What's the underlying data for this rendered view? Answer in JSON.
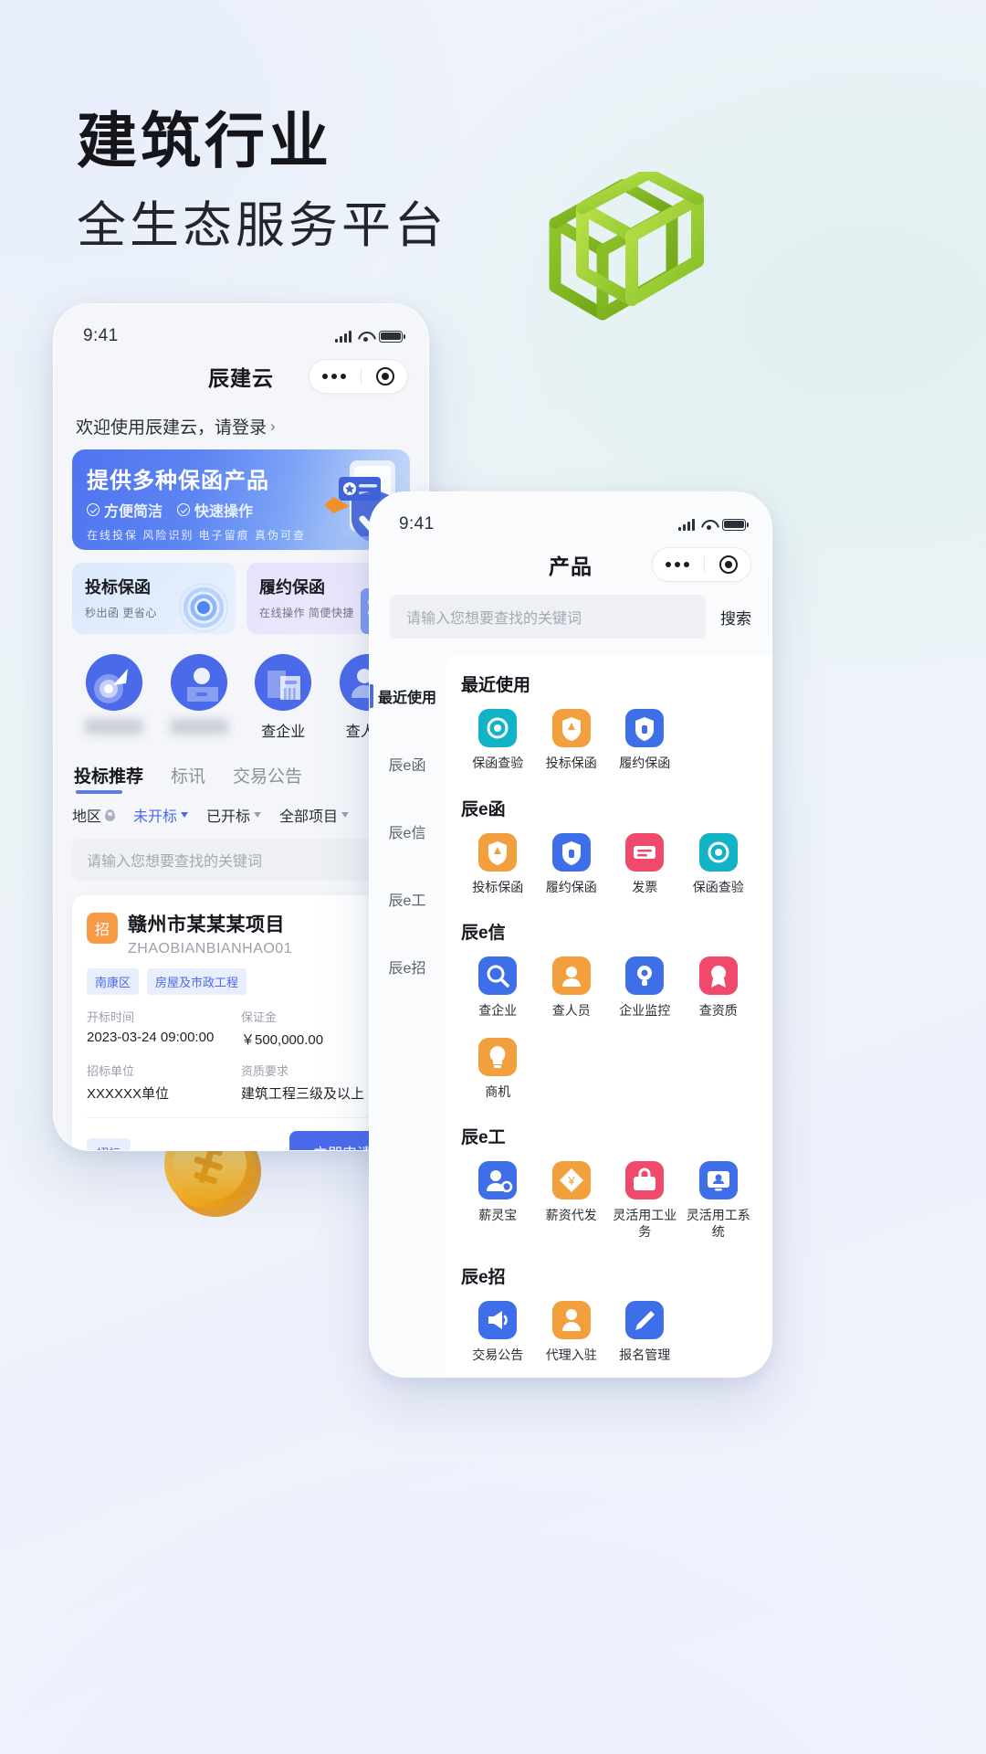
{
  "headline": {
    "line1": "建筑行业",
    "line2": "全生态服务平台"
  },
  "decor": {
    "cube_icon": "wireframe-cube-icon",
    "coin_icon": "gold-coin-icon"
  },
  "phoneA": {
    "status": {
      "time": "9:41",
      "signal_icon": "signal-bars-icon",
      "wifi_icon": "wifi-icon",
      "battery_icon": "battery-icon"
    },
    "nav": {
      "title": "辰建云",
      "more_icon": "more-dots-icon",
      "target_icon": "target-circle-icon"
    },
    "welcome": {
      "text": "欢迎使用辰建云，请登录",
      "chevron": "›"
    },
    "banner": {
      "title": "提供多种保函产品",
      "feature1": "方便简洁",
      "feature2": "快速操作",
      "tags": "在线投保  风险识别  电子留痕  真伪可查",
      "art_icon": "phone-shield-illustration"
    },
    "guarantee_cards": [
      {
        "title": "投标保函",
        "subtitle": "秒出函 更省心",
        "icon": "rings-target-icon"
      },
      {
        "title": "履约保函",
        "subtitle": "在线操作 简便快捷",
        "icon": "document-lines-icon"
      }
    ],
    "quick_icons": [
      {
        "label": "",
        "blurred": true,
        "icon": "bid-target-icon"
      },
      {
        "label": "",
        "blurred": true,
        "icon": "person-card-icon"
      },
      {
        "label": "查企业",
        "blurred": false,
        "icon": "company-building-icon"
      },
      {
        "label": "查人员",
        "blurred": false,
        "icon": "person-search-icon"
      }
    ],
    "tabs": [
      {
        "label": "投标推荐",
        "active": true
      },
      {
        "label": "标讯",
        "active": false
      },
      {
        "label": "交易公告",
        "active": false
      }
    ],
    "filters": [
      {
        "label": "地区",
        "type": "pin",
        "active": false
      },
      {
        "label": "未开标",
        "type": "arrow",
        "active": true
      },
      {
        "label": "已开标",
        "type": "arrow",
        "active": false
      },
      {
        "label": "全部项目",
        "type": "arrow",
        "active": false
      }
    ],
    "search": {
      "placeholder": "请输入您想要查找的关键词"
    },
    "project": {
      "badge": "招",
      "title": "赣州市某某某项目",
      "code": "ZHAOBIANBIANHAO01",
      "star_icon": "star-outline-icon",
      "chips": [
        "南康区",
        "房屋及市政工程"
      ],
      "fields": [
        {
          "label": "开标时间",
          "value": "2023-03-24 09:00:00"
        },
        {
          "label": "保证金",
          "value": "￥500,000.00"
        },
        {
          "label": "招标单位",
          "value": "XXXXXX单位"
        },
        {
          "label": "资质要求",
          "value": "建筑工程三级及以上"
        }
      ],
      "footer_chip": "招标",
      "apply_button": "立即申请"
    }
  },
  "phoneB": {
    "status": {
      "time": "9:41",
      "signal_icon": "signal-bars-icon",
      "wifi_icon": "wifi-icon",
      "battery_icon": "battery-icon"
    },
    "nav": {
      "title": "产品",
      "more_icon": "more-dots-icon",
      "target_icon": "target-circle-icon"
    },
    "search": {
      "placeholder": "请输入您想要查找的关键词",
      "button": "搜索"
    },
    "sidebar": [
      {
        "label": "最近使用",
        "active": true
      },
      {
        "label": "辰e函",
        "active": false
      },
      {
        "label": "辰e信",
        "active": false
      },
      {
        "label": "辰e工",
        "active": false
      },
      {
        "label": "辰e招",
        "active": false
      }
    ],
    "sections": [
      {
        "title": "最近使用",
        "items": [
          {
            "label": "保函查验",
            "icon": "seal-check-icon",
            "color": "#12b3c6"
          },
          {
            "label": "投标保函",
            "icon": "shield-arrow-icon",
            "color": "#f2a03d"
          },
          {
            "label": "履约保函",
            "icon": "shield-lock-icon",
            "color": "#3f6fe8"
          }
        ]
      },
      {
        "title": "辰e函",
        "items": [
          {
            "label": "投标保函",
            "icon": "shield-arrow-icon",
            "color": "#f2a03d"
          },
          {
            "label": "履约保函",
            "icon": "shield-lock-icon",
            "color": "#3f6fe8"
          },
          {
            "label": "发票",
            "icon": "invoice-icon",
            "color": "#ef4a6b"
          },
          {
            "label": "保函查验",
            "icon": "seal-check-icon",
            "color": "#12b3c6"
          }
        ]
      },
      {
        "title": "辰e信",
        "items": [
          {
            "label": "查企业",
            "icon": "company-search-icon",
            "color": "#3f6fe8"
          },
          {
            "label": "查人员",
            "icon": "person-search-icon",
            "color": "#f2a03d"
          },
          {
            "label": "企业监控",
            "icon": "monitor-eye-icon",
            "color": "#3f6fe8"
          },
          {
            "label": "查资质",
            "icon": "award-icon",
            "color": "#ef4a6b"
          },
          {
            "label": "商机",
            "icon": "bulb-icon",
            "color": "#f2a03d"
          }
        ]
      },
      {
        "title": "辰e工",
        "items": [
          {
            "label": "薪灵宝",
            "icon": "worker-icon",
            "color": "#3f6fe8"
          },
          {
            "label": "薪资代发",
            "icon": "coin-hand-icon",
            "color": "#f2a03d"
          },
          {
            "label": "灵活用工业务",
            "icon": "toolbox-icon",
            "color": "#ef4a6b"
          },
          {
            "label": "灵活用工系统",
            "icon": "monitor-person-icon",
            "color": "#3f6fe8"
          }
        ]
      },
      {
        "title": "辰e招",
        "items": [
          {
            "label": "交易公告",
            "icon": "megaphone-icon",
            "color": "#3f6fe8"
          },
          {
            "label": "代理入驻",
            "icon": "agent-person-icon",
            "color": "#f2a03d"
          },
          {
            "label": "报名管理",
            "icon": "pen-edit-icon",
            "color": "#3f6fe8"
          }
        ]
      }
    ]
  },
  "colors": {
    "primary": "#4a6aea",
    "accent_orange": "#f79a46",
    "cube_green": "#9ed13a"
  }
}
